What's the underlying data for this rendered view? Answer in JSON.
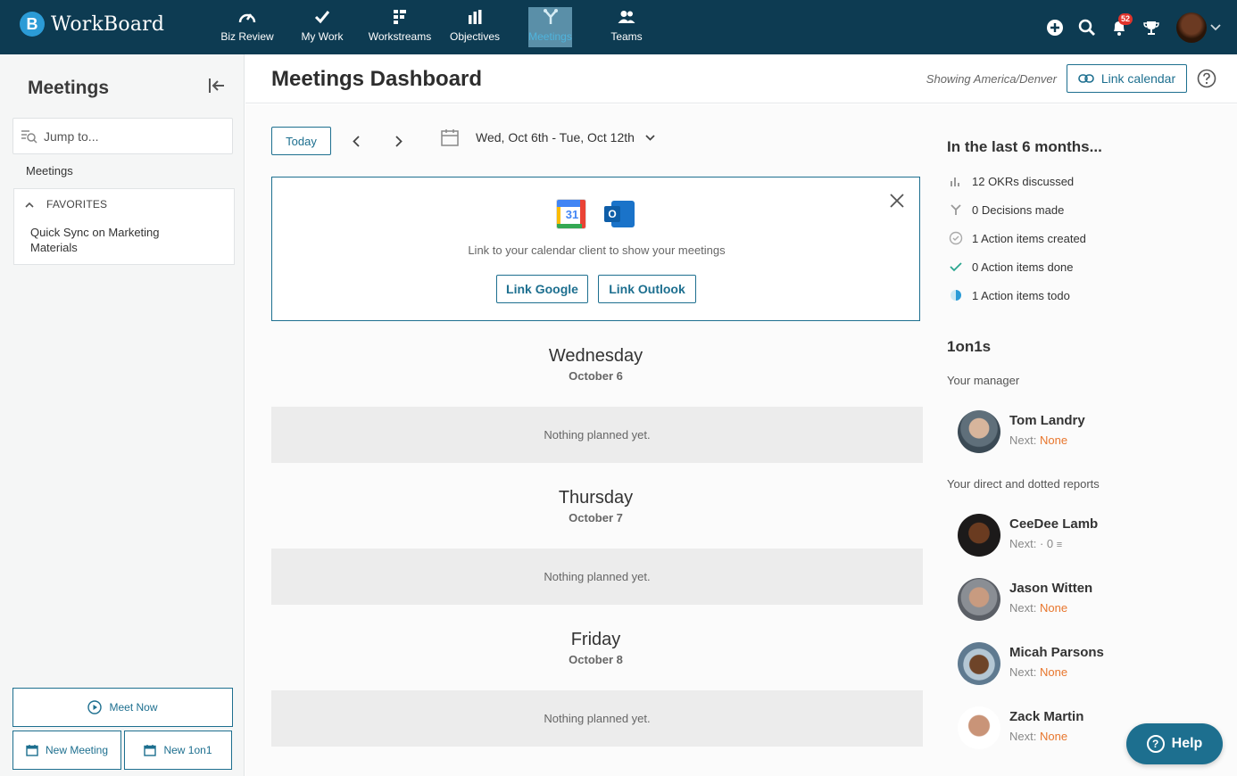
{
  "app": {
    "name": "WorkBoard"
  },
  "nav": {
    "items": [
      {
        "label": "Biz Review",
        "icon": "gauge-icon"
      },
      {
        "label": "My Work",
        "icon": "checkmark-icon"
      },
      {
        "label": "Workstreams",
        "icon": "workstreams-icon"
      },
      {
        "label": "Objectives",
        "icon": "bar-chart-icon"
      },
      {
        "label": "Meetings",
        "icon": "meetings-icon",
        "active": true
      },
      {
        "label": "Teams",
        "icon": "people-icon"
      }
    ],
    "notification_count": "52"
  },
  "sidebar": {
    "title": "Meetings",
    "search_placeholder": "Jump to...",
    "section_label": "Meetings",
    "favorites_label": "FAVORITES",
    "favorite_items": [
      "Quick Sync on Marketing Materials"
    ],
    "meet_now": "Meet Now",
    "new_meeting": "New Meeting",
    "new_1on1": "New 1on1"
  },
  "header": {
    "title": "Meetings Dashboard",
    "timezone": "Showing America/Denver",
    "link_calendar": "Link calendar"
  },
  "toolbar": {
    "today": "Today",
    "date_range": "Wed, Oct 6th - Tue, Oct 12th"
  },
  "link_panel": {
    "google_day": "31",
    "outlook_letter": "O",
    "message": "Link to your calendar client to show your meetings",
    "google_btn": "Link Google",
    "outlook_btn": "Link Outlook"
  },
  "days": [
    {
      "name": "Wednesday",
      "date": "October 6",
      "empty_text": "Nothing planned yet."
    },
    {
      "name": "Thursday",
      "date": "October 7",
      "empty_text": "Nothing planned yet."
    },
    {
      "name": "Friday",
      "date": "October 8",
      "empty_text": "Nothing planned yet."
    }
  ],
  "stats": {
    "title": "In the last 6 months...",
    "items": [
      {
        "text": "12 OKRs discussed",
        "icon": "bar-chart-icon"
      },
      {
        "text": "0 Decisions made",
        "icon": "decision-icon"
      },
      {
        "text": "1 Action items created",
        "icon": "circle-check-icon"
      },
      {
        "text": "0 Action items done",
        "icon": "check-icon"
      },
      {
        "text": "1 Action items todo",
        "icon": "half-circle-icon"
      }
    ]
  },
  "oneonones": {
    "title": "1on1s",
    "manager_label": "Your manager",
    "reports_label": "Your direct and dotted reports",
    "next_label": "Next:",
    "manager": {
      "name": "Tom Landry",
      "next": "None"
    },
    "reports": [
      {
        "name": "CeeDee Lamb",
        "next": "· 0"
      },
      {
        "name": "Jason Witten",
        "next": "None"
      },
      {
        "name": "Micah Parsons",
        "next": "None"
      },
      {
        "name": "Zack Martin",
        "next": "None"
      }
    ]
  },
  "help": {
    "label": "Help"
  },
  "colors": {
    "navbar": "#0d3b52",
    "accent": "#1d6f8f",
    "next_none": "#e8762d"
  }
}
